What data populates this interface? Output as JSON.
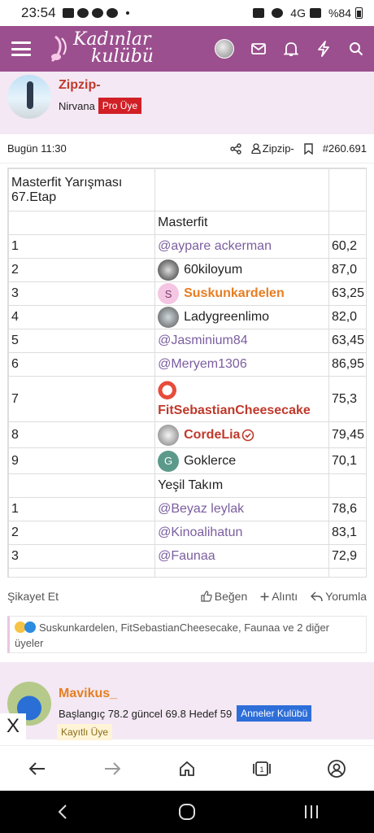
{
  "status": {
    "time": "23:54",
    "battery": "%84",
    "net": "4G"
  },
  "header": {
    "logo_line1": "Kadınlar",
    "logo_line2": "kulübü"
  },
  "post": {
    "username": "Zipzip-",
    "rank": "Nirvana",
    "badge": "Pro Üye",
    "time": "Bugün 11:30",
    "author_link": "Zipzip-",
    "post_no": "#260.691"
  },
  "table": {
    "title": "Masterfit Yarışması 67.Etap",
    "group1": "Masterfit",
    "rows1": [
      {
        "no": "1",
        "name": "@aypare ackerman",
        "value": "60,2",
        "style": "mention"
      },
      {
        "no": "2",
        "name": "60kiloyum",
        "value": "87,0",
        "style": "user"
      },
      {
        "no": "3",
        "name": "Suskunkardelen",
        "value": "63,25",
        "style": "orange",
        "initial": "S"
      },
      {
        "no": "4",
        "name": "Ladygreenlimo",
        "value": "82,0",
        "style": "user"
      },
      {
        "no": "5",
        "name": "@Jasminium84",
        "value": "63,45",
        "style": "mention"
      },
      {
        "no": "6",
        "name": "@Meryem1306",
        "value": "86,95",
        "style": "mention"
      },
      {
        "no": "7",
        "name": "FitSebastianCheesecake",
        "value": "75,3",
        "style": "red"
      },
      {
        "no": "8",
        "name": "CordeLia",
        "value": "79,45",
        "style": "red"
      },
      {
        "no": "9",
        "name": "Goklerce",
        "value": "70,1",
        "style": "user",
        "initial": "G"
      }
    ],
    "group2": "Yeşil Takım",
    "rows2": [
      {
        "no": "1",
        "name": "@Beyaz leylak",
        "value": "78,6"
      },
      {
        "no": "2",
        "name": "@Kinoalihatun",
        "value": "83,1"
      },
      {
        "no": "3",
        "name": "@Faunaa",
        "value": "72,9"
      }
    ]
  },
  "actions": {
    "report": "Şikayet Et",
    "like": "Beğen",
    "quote": "Alıntı",
    "reply": "Yorumla"
  },
  "reactions": {
    "text": "Suskunkardelen, FitSebastianCheesecake, Faunaa ve 2 diğer üyeler"
  },
  "post2": {
    "username": "Mavikus_",
    "subtitle": "Başlangıç 78.2 güncel 69.8 Hedef 59",
    "badge": "Anneler Kulübü",
    "badge2": "Kayıtlı Üye"
  },
  "close_label": "X",
  "colors": {
    "brand": "#9b4f8e",
    "post_bg": "#f3e8f3",
    "mention": "#7b5ea0",
    "orange": "#e67e22",
    "red": "#c0392b"
  }
}
